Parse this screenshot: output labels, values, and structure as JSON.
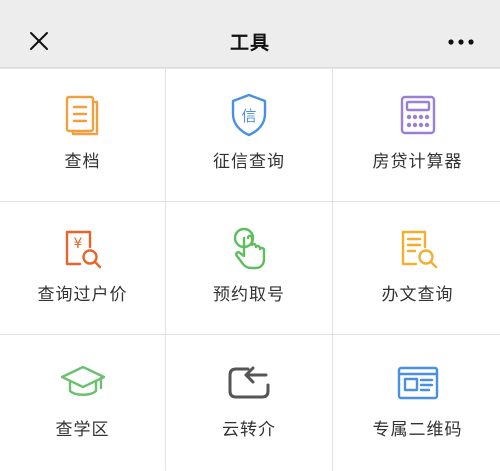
{
  "header": {
    "title": "工具",
    "close_icon": "close-icon",
    "more_icon": "more-icon"
  },
  "tools": [
    {
      "label": "查档",
      "icon": "document-icon",
      "color": "#f0a040"
    },
    {
      "label": "征信查询",
      "icon": "shield-credit-icon",
      "color": "#4a90e2"
    },
    {
      "label": "房贷计算器",
      "icon": "calculator-icon",
      "color": "#9b7fd4"
    },
    {
      "label": "查询过户价",
      "icon": "price-search-icon",
      "color": "#e8642c"
    },
    {
      "label": "预约取号",
      "icon": "tap-hand-icon",
      "color": "#5cbf5c"
    },
    {
      "label": "办文查询",
      "icon": "document-search-icon",
      "color": "#f0b030"
    },
    {
      "label": "查学区",
      "icon": "graduation-cap-icon",
      "color": "#6cc070"
    },
    {
      "label": "云转介",
      "icon": "referral-arrow-icon",
      "color": "#555555"
    },
    {
      "label": "专属二维码",
      "icon": "id-card-icon",
      "color": "#4a90e2"
    }
  ]
}
